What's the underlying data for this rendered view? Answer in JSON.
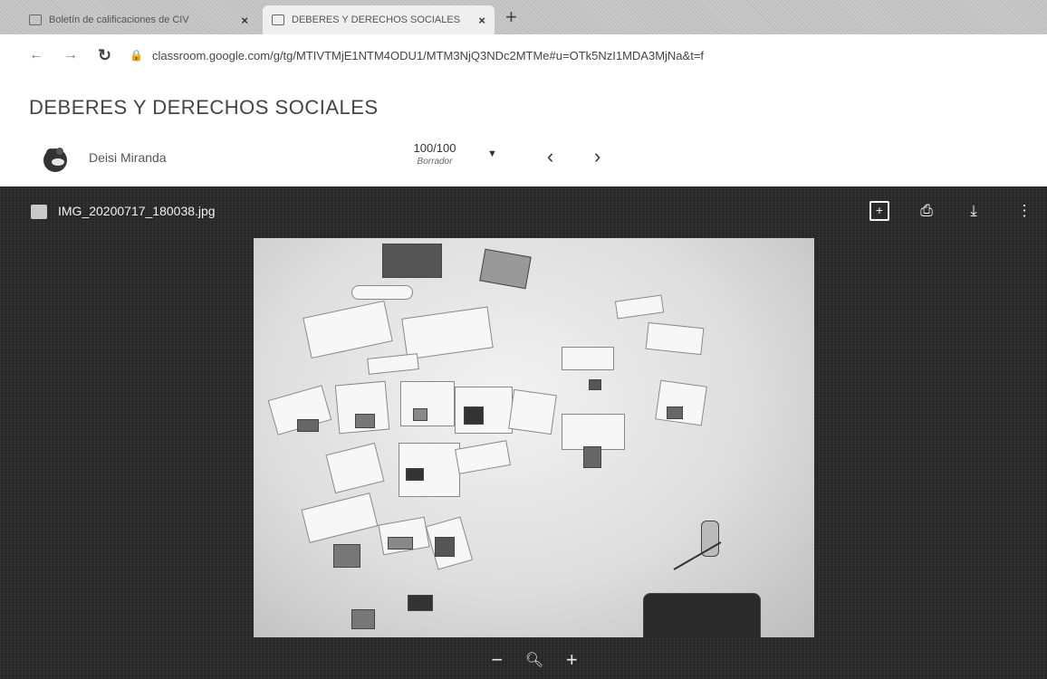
{
  "browser": {
    "tabs": [
      {
        "label": "Boletín de calificaciones de CIV",
        "close": "×"
      },
      {
        "label": "DEBERES Y DERECHOS SOCIALES",
        "close": "×"
      }
    ],
    "new_tab": "+",
    "url": "classroom.google.com/g/tg/MTIVTMjE1NTM4ODU1/MTM3NjQ3NDc2MTMe#u=OTk5NzI1MDA3MjNa&t=f"
  },
  "page": {
    "title": "DEBERES Y DERECHOS SOCIALES"
  },
  "student": {
    "name": "Deisi Miranda",
    "grade": "100/100",
    "grade_status": "Borrador",
    "prev": "‹",
    "next": "›"
  },
  "viewer": {
    "filename": "IMG_20200717_180038.jpg",
    "zoom_out": "−",
    "zoom_in": "+"
  },
  "icons": {
    "comment": "add-comment-icon",
    "print": "print-icon",
    "download": "download-icon",
    "more": "more-vert-icon",
    "zoom": "zoom-icon"
  }
}
